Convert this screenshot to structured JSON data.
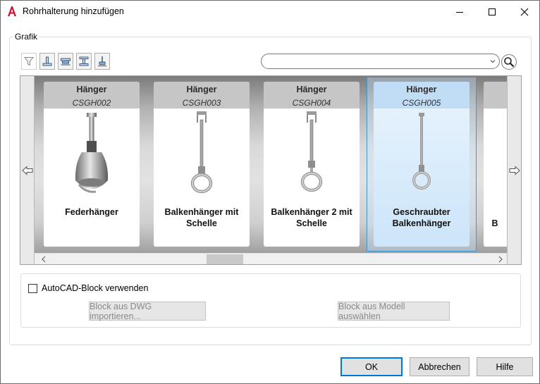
{
  "window": {
    "title": "Rohrhalterung hinzufügen"
  },
  "grafik": {
    "legend": "Grafik",
    "filters": [
      {
        "icon": "funnel-icon"
      },
      {
        "icon": "support-base-icon"
      },
      {
        "icon": "beam-clamp-icon"
      },
      {
        "icon": "i-beam-icon"
      },
      {
        "icon": "hanger-rod-icon"
      }
    ],
    "search": {
      "value": "",
      "placeholder": ""
    },
    "cards": [
      {
        "category": "Hänger",
        "code": "CSGH002",
        "name": "Federhänger",
        "selected": false
      },
      {
        "category": "Hänger",
        "code": "CSGH003",
        "name": "Balkenhänger mit Schelle",
        "selected": false
      },
      {
        "category": "Hänger",
        "code": "CSGH004",
        "name": "Balkenhänger 2 mit Schelle",
        "selected": false
      },
      {
        "category": "Hänger",
        "code": "CSGH005",
        "name": "Geschraubter Balkenhänger",
        "selected": true
      },
      {
        "category": "",
        "code": "",
        "name": "B",
        "selected": false
      }
    ]
  },
  "block": {
    "checkbox_label": "AutoCAD-Block verwenden",
    "checked": false,
    "import_button": "Block aus DWG importieren...",
    "select_button": "Block aus Modell auswählen"
  },
  "footer": {
    "ok": "OK",
    "cancel": "Abbrechen",
    "help": "Hilfe"
  },
  "colors": {
    "accent": "#0078d7",
    "selection_border": "#3c98d8",
    "app_icon": "#d2122e"
  }
}
